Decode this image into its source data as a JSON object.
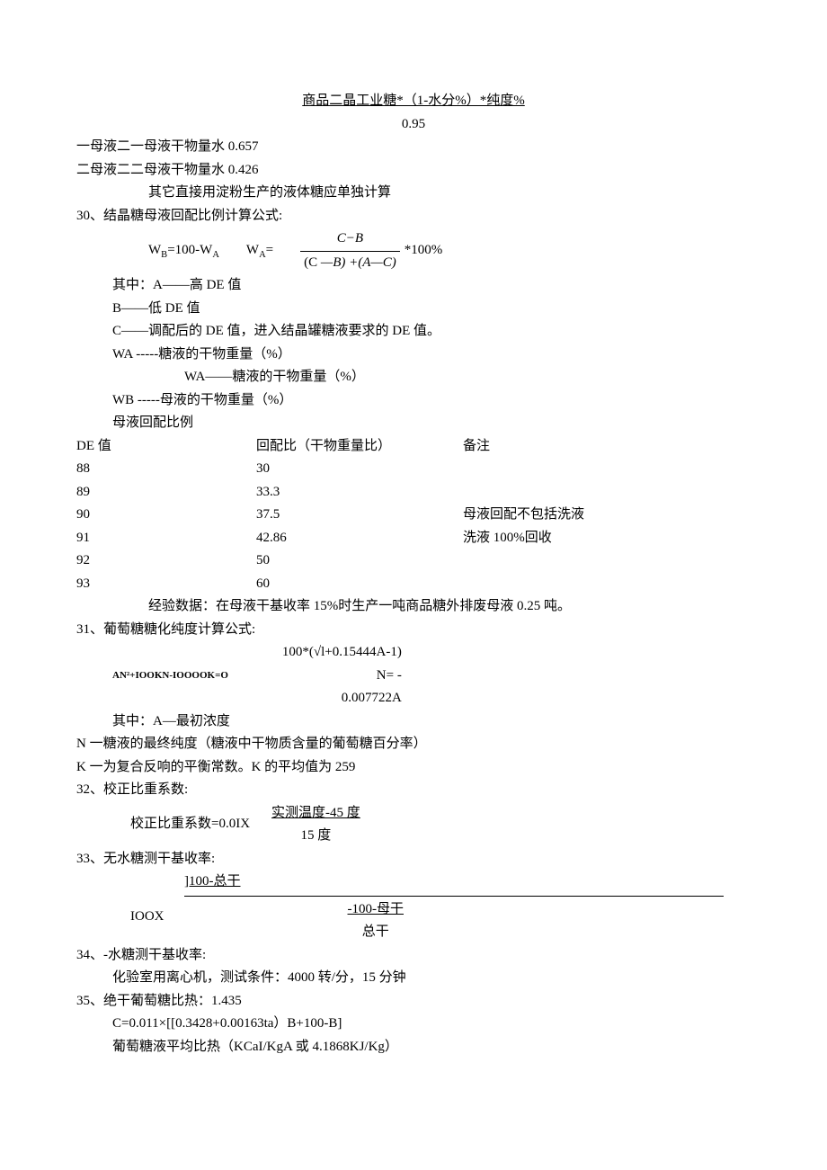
{
  "top": {
    "formula": "商品二晶工业糖*（1-水分%）*纯度%",
    "den": "0.95"
  },
  "muye": {
    "line1": "一母液二一母液干物量水 0.657",
    "line2": "二母液二二母液干物量水 0.426",
    "note": "其它直接用淀粉生产的液体糖应单独计算"
  },
  "s30": {
    "title": "30、结晶糖母液回配比例计算公式:",
    "wb": "W",
    "wb_sub": "B",
    "eq1_mid": "=100-W",
    "wa_sub": "A",
    "wa_eq": "W",
    "wa_eq_sub": "A",
    "eq": "=",
    "frac_num": "C−B",
    "frac_den_a": "(C ",
    "frac_den_b": "—B) +(A—C)",
    "suffix": " *100%",
    "where": "其中：A——高 DE 值",
    "b": "B——低 DE 值",
    "c": "C——调配后的 DE 值，进入结晶罐糖液要求的 DE 值。",
    "wa_desc": "WA -----糖液的干物重量（%）",
    "wa_desc2": "WA——糖液的干物重量（%）",
    "wb_desc": "WB -----母液的干物重量（%）",
    "ratio_title": "母液回配比例"
  },
  "table": {
    "h1": "DE 值",
    "h2": "回配比（干物重量比）",
    "h3": "备注",
    "rows": [
      {
        "de": "88",
        "ratio": "30",
        "note": ""
      },
      {
        "de": "89",
        "ratio": "33.3",
        "note": ""
      },
      {
        "de": "90",
        "ratio": "37.5",
        "note": "母液回配不包括洗液"
      },
      {
        "de": "91",
        "ratio": "42.86",
        "note": "洗液 100%回收"
      },
      {
        "de": "92",
        "ratio": "50",
        "note": ""
      },
      {
        "de": "93",
        "ratio": "60",
        "note": ""
      }
    ],
    "exp": "经验数据：在母液干基收率 15%时生产一吨商品糖外排废母液 0.25 吨。"
  },
  "s31": {
    "title": "31、葡萄糖糖化纯度计算公式:",
    "eq_left": "AN²+IOOKN-IOOOOK=O",
    "frac_num": "100*(√l+0.15444A-1)",
    "n_eq": "N= -",
    "den": "0.007722A",
    "where_a": "其中：A—最初浓度",
    "where_n": "N 一糖液的最终纯度（糖液中干物质含量的葡萄糖百分率）",
    "where_k": "K 一为复合反响的平衡常数。K 的平均值为 259"
  },
  "s32": {
    "title": "32、校正比重系数:",
    "left": "校正比重系数=0.0IX",
    "num": "实测温度-45 度",
    "den": "15 度"
  },
  "s33": {
    "title": "33、无水糖测干基收率:",
    "top": "]100-总干",
    "ioox": "IOOX",
    "num": "-100-母干",
    "den": "总干"
  },
  "s34": {
    "title": "34、-水糖测干基收率:",
    "line": "化验室用离心机，测试条件：4000 转/分，15 分钟"
  },
  "s35": {
    "title": "35、绝干葡萄糖比热：1.435",
    "line1": "C=0.011×[[0.3428+0.00163ta）B+100-B]",
    "line2": "葡萄糖液平均比热（KCaI/KgA 或 4.1868KJ/Kg）"
  }
}
